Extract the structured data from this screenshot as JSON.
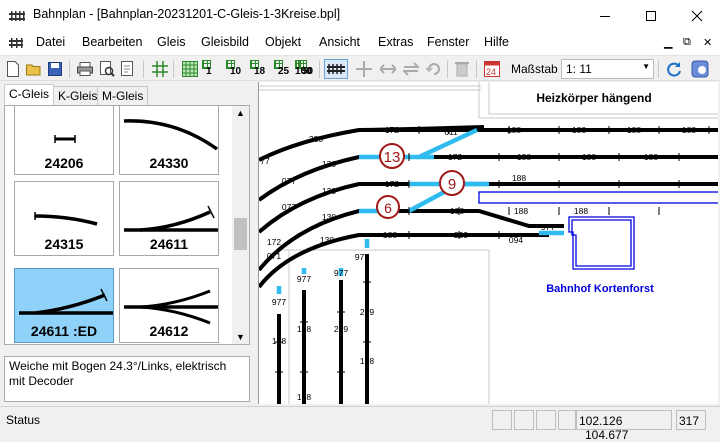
{
  "window": {
    "title": "Bahnplan - [Bahnplan-20231201-C-Gleis-1-3Kreise.bpl]",
    "minimize_icon": "minimize-icon",
    "maximize_icon": "maximize-icon",
    "close_icon": "close-icon"
  },
  "menu": [
    "Datei",
    "Bearbeiten",
    "Gleis",
    "Gleisbild",
    "Objekt",
    "Ansicht",
    "Extras",
    "Fenster",
    "Hilfe"
  ],
  "toolbar": {
    "grid_buttons": [
      "1",
      "10",
      "18",
      "25",
      "50",
      "100"
    ],
    "scale_label": "Maßstab",
    "scale_value": "1:  11"
  },
  "tabs": [
    "C-Gleis",
    "K-Gleis",
    "M-Gleis"
  ],
  "palette": [
    {
      "label": "24206"
    },
    {
      "label": "24330"
    },
    {
      "label": "24315"
    },
    {
      "label": "24611"
    },
    {
      "label": "24611 :ED"
    },
    {
      "label": "24612"
    }
  ],
  "description": "Weiche mit Bogen 24.3°/Links, elektrisch mit Decoder",
  "plan": {
    "heater_label": "Heizkörper hängend",
    "station_label": "Bahnhof Kortenforst",
    "turnout_numbers": [
      "13",
      "9",
      "6"
    ],
    "track_labels": [
      "330",
      "611",
      "172",
      "188",
      "188",
      "188",
      "188",
      "77",
      "130",
      "172",
      "188",
      "188",
      "188",
      "077",
      "130",
      "172",
      "188",
      "077",
      "130",
      "188",
      "188",
      "188",
      "172",
      "130",
      "188",
      "229",
      "094",
      "977",
      "071",
      "977",
      "977",
      "977",
      "977",
      "188",
      "229",
      "229",
      "188",
      "188",
      "188"
    ],
    "colors": {
      "track": "#000000",
      "selected_track": "#2fbbef",
      "station": "#0000e0",
      "turnout_circle": "#a01818"
    }
  },
  "status": {
    "text": "Status",
    "x": "102.126",
    "y": "104.677",
    "value": "317"
  }
}
